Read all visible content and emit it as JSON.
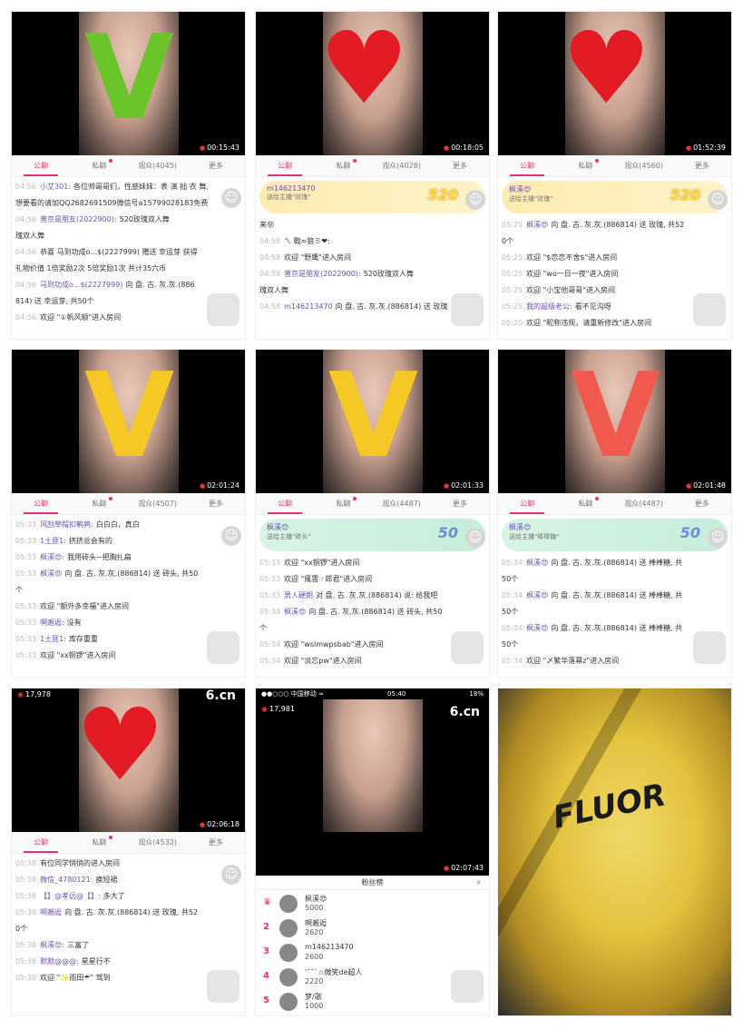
{
  "colors": {
    "accent": "#e8317a",
    "username": "#6b4fb3",
    "record": "#e33333"
  },
  "common": {
    "tabs": [
      "公聊",
      "私聊",
      "观众",
      "更多"
    ]
  },
  "panels": [
    {
      "overlay": "V",
      "overlay_color": "#6bc42a",
      "time": "00:15:43",
      "audience": "观众(4045)",
      "messages": [
        {
          "t": "04:56",
          "u": "小艾301:",
          "text": "各位帅哥哥们，性感妹妹：表 演 拙 衣 舞,"
        },
        {
          "t": "",
          "u": "",
          "text": "想要看的请加QQ2682691509微信号a15799028183免费"
        },
        {
          "t": "04:56",
          "u": "普京是朋友(2022900):",
          "text": "520玫瑰双人舞"
        },
        {
          "t": "",
          "u": "",
          "text": "瑰双人舞"
        },
        {
          "t": "04:56",
          "u": "",
          "text": "恭喜 马到功成o...$(2227999) 赠送 幸运芽 获得"
        },
        {
          "t": "",
          "u": "",
          "text": "礼物价值 1倍奖励2次  5倍奖励1次  共计35六币"
        },
        {
          "t": "04:56",
          "u": "马到功成o...$(2227999)",
          "text": "向 盘. 古. 灰.灰.(886"
        },
        {
          "t": "",
          "u": "",
          "text": "814) 送 幸运芽, 共50个"
        },
        {
          "t": "04:56",
          "u": "",
          "text": "欢迎 \"①帆风顺\"进入房间"
        }
      ]
    },
    {
      "overlay": "♥",
      "time": "00:18:05",
      "audience": "观众(4028)",
      "gift": {
        "name": "m146213470",
        "sub": "送给主播\"玫瑰\"",
        "count": "520"
      },
      "messages": [
        {
          "t": "",
          "u": "",
          "text": "来😝"
        },
        {
          "t": "04:58",
          "u": "",
          "text": "ㄟ 戰≈狼ミ❤:"
        },
        {
          "t": "04:58",
          "u": "",
          "text": "欢迎 \"野鹰\"进入房间"
        },
        {
          "t": "04:58",
          "u": "普京是朋友(2022900):",
          "text": "520玫瑰双人舞"
        },
        {
          "t": "",
          "u": "",
          "text": "瑰双人舞"
        },
        {
          "t": "04:58",
          "u": "m146213470",
          "text": "向 盘. 古. 灰.灰.(886814) 送 玫瑰"
        }
      ]
    },
    {
      "overlay": "♥",
      "time": "01:52:39",
      "audience": "观众(4560)",
      "gift": {
        "name": "枫溪😍",
        "sub": "送给主播\"玫瑰\"",
        "count": "520"
      },
      "messages": [
        {
          "t": "05:25",
          "u": "枫溪😍",
          "text": "向 盘. 古. 灰.灰.(886814) 送 玫瑰, 共52"
        },
        {
          "t": "",
          "u": "",
          "text": "0个"
        },
        {
          "t": "05:25",
          "u": "",
          "text": "欢迎 \"$恋恋不舍$\"进入房间"
        },
        {
          "t": "05:25",
          "u": "",
          "text": "欢迎 \"wo一日一夜\"进入房间"
        },
        {
          "t": "05:25",
          "u": "",
          "text": "欢迎 \"小宝他哥哥\"进入房间"
        },
        {
          "t": "05:25",
          "u": "我的超级老公:",
          "text": "看不见沟呀"
        },
        {
          "t": "05:25",
          "u": "",
          "text": "欢迎 \"昵称违规，请重新修改\"进入房间"
        }
      ]
    },
    {
      "overlay": "V",
      "overlay_color": "#f6c826",
      "time": "02:01:24",
      "audience": "观众(4507)",
      "messages": [
        {
          "t": "05:33",
          "u": "风刮草帽扣鹌鹑:",
          "text": "白白白，真白"
        },
        {
          "t": "05:33",
          "u": "1土匪1:",
          "text": "挤挤总会有的"
        },
        {
          "t": "05:33",
          "u": "枫溪😍:",
          "text": "我用砖头~把胸扎扁"
        },
        {
          "t": "05:33",
          "u": "枫溪😍",
          "text": "向 盘. 古. 灰.灰.(886814) 送 砖头, 共50"
        },
        {
          "t": "",
          "u": "",
          "text": "个"
        },
        {
          "t": "05:33",
          "u": "",
          "text": "欢迎 \"额外多幸福\"进入房间"
        },
        {
          "t": "05:33",
          "u": "啊邂逅:",
          "text": "没有"
        },
        {
          "t": "05:33",
          "u": "1土匪1:",
          "text": "库存重重"
        },
        {
          "t": "05:33",
          "u": "",
          "text": "欢迎 \"xx铜锣\"进入房间"
        }
      ]
    },
    {
      "overlay": "V",
      "overlay_color": "#f6c826",
      "time": "02:01:33",
      "audience": "观众(4487)",
      "gift": {
        "name": "枫溪😍",
        "sub": "送给主播\"砖头\"",
        "count": "50",
        "green": true
      },
      "messages": [
        {
          "t": "05:33",
          "u": "",
          "text": "欢迎 \"xx铜锣\"进入房间"
        },
        {
          "t": "05:33",
          "u": "",
          "text": "欢迎 \"風雲☞郎君\"进入房间"
        },
        {
          "t": "05:33",
          "u": "男人硬朗",
          "text": "对 盘. 古. 灰.灰.(886814) 说: 给我吧"
        },
        {
          "t": "05:34",
          "u": "枫溪😍",
          "text": "向 盘. 古. 灰.灰.(886814) 送 砖头, 共50"
        },
        {
          "t": "",
          "u": "",
          "text": "个"
        },
        {
          "t": "05:34",
          "u": "",
          "text": "欢迎 \"wslmwpsbab\"进入房间"
        },
        {
          "t": "05:34",
          "u": "",
          "text": "欢迎 \"淡忘pw\"进入房间"
        }
      ]
    },
    {
      "overlay": "V",
      "overlay_color": "#f05a4e",
      "time": "02:01:48",
      "audience": "观众(4487)",
      "gift": {
        "name": "枫溪😍",
        "sub": "送给主播\"棒棒糖\"",
        "count": "50",
        "green": true
      },
      "messages": [
        {
          "t": "05:34",
          "u": "枫溪😍",
          "text": "向 盘. 古. 灰.灰.(886814) 送 棒棒糖, 共"
        },
        {
          "t": "",
          "u": "",
          "text": "50个"
        },
        {
          "t": "05:34",
          "u": "枫溪😍",
          "text": "向 盘. 古. 灰.灰.(886814) 送 棒棒糖, 共"
        },
        {
          "t": "",
          "u": "",
          "text": "50个"
        },
        {
          "t": "05:34",
          "u": "枫溪😍",
          "text": "向 盘. 古. 灰.灰.(886814) 送 棒棒糖, 共"
        },
        {
          "t": "",
          "u": "",
          "text": "50个"
        },
        {
          "t": "05:34",
          "u": "",
          "text": "欢迎 \"〆繁华落幕z\"进入房间"
        }
      ]
    },
    {
      "overlay": "♥",
      "time": "02:06:18",
      "audience": "观众(4532)",
      "fans": "17,978",
      "brand": "6.cn",
      "messages": [
        {
          "t": "05:38",
          "u": "",
          "text": "有位同学悄悄的进入房间"
        },
        {
          "t": "05:38",
          "u": "微信_4780121:",
          "text": "换短裙"
        },
        {
          "t": "05:38",
          "u": "【】@孝远@【】:",
          "text": "多大了"
        },
        {
          "t": "05:38",
          "u": "啊邂逅",
          "text": "向 盘. 古. 灰.灰.(886814) 送 玫瑰, 共52"
        },
        {
          "t": "",
          "u": "",
          "text": "0个"
        },
        {
          "t": "05:38",
          "u": "枫溪😍:",
          "text": "三富了"
        },
        {
          "t": "05:38",
          "u": "默默@@@:",
          "text": "星星行不"
        },
        {
          "t": "05:38",
          "u": "",
          "text": "欢迎 \"✨雨田☔\" 驾到"
        }
      ]
    },
    {
      "status": {
        "carrier": "●●○○○ 中国移动 ≈",
        "clock": "05:40",
        "battery": "18%"
      },
      "fans": "17,981",
      "brand": "6.cn",
      "time": "02:07:43",
      "ranking_title": "粉丝榜",
      "ranking": [
        {
          "rank": "♛",
          "name": "枫溪😍",
          "score": "5000"
        },
        {
          "rank": "2",
          "name": "啊邂逅",
          "score": "2620"
        },
        {
          "rank": "3",
          "name": "m146213470",
          "score": "2600"
        },
        {
          "rank": "4",
          "name": "'¯¯`☆微笑de超人",
          "score": "2220"
        },
        {
          "rank": "5",
          "name": "梦/歌",
          "score": "1000"
        }
      ]
    },
    {
      "photo_text": "FLUOR"
    }
  ]
}
